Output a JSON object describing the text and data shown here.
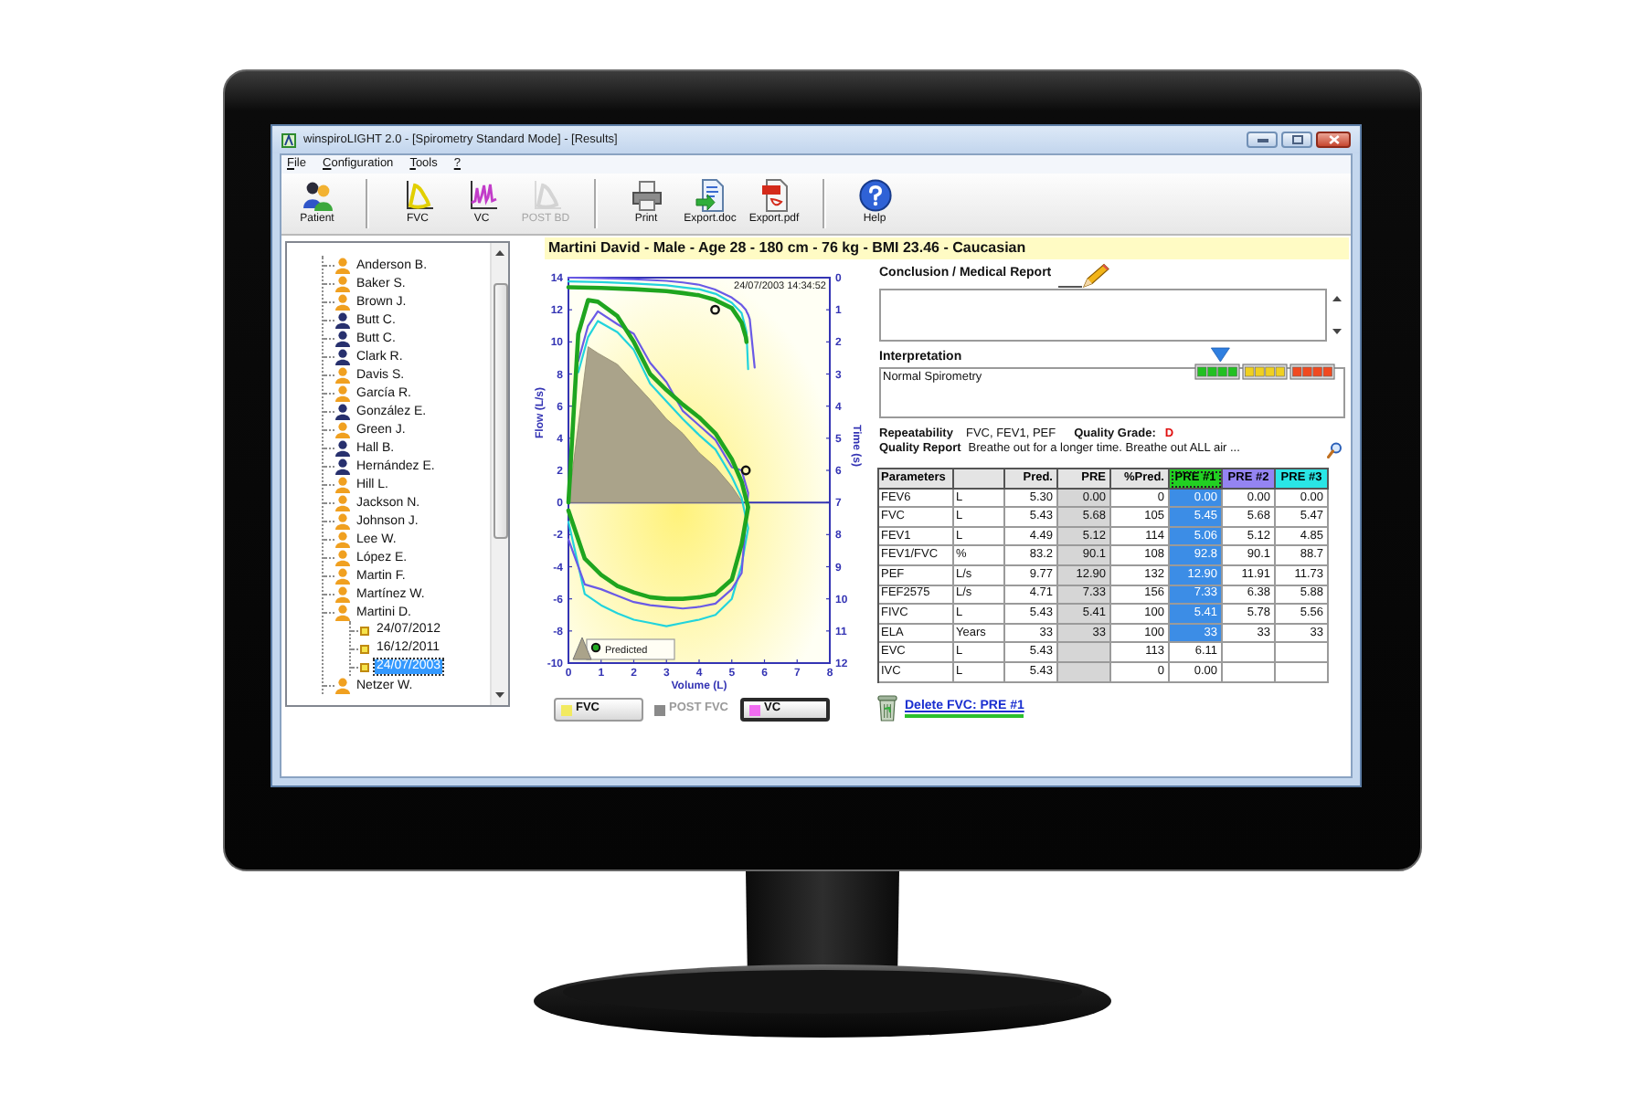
{
  "window": {
    "title": "winspiroLIGHT 2.0 - [Spirometry Standard Mode] - [Results]"
  },
  "menu": [
    {
      "label": "File"
    },
    {
      "label": "Configuration"
    },
    {
      "label": "Tools"
    },
    {
      "label": "?"
    }
  ],
  "toolbar": [
    {
      "items": [
        {
          "kind": "patient",
          "label": "Patient",
          "disabled": false
        }
      ]
    },
    {
      "items": [
        {
          "kind": "fvc",
          "label": "FVC",
          "disabled": false
        },
        {
          "kind": "vc",
          "label": "VC",
          "disabled": false
        },
        {
          "kind": "post-bd",
          "label": "POST BD",
          "disabled": true
        }
      ]
    },
    {
      "items": [
        {
          "kind": "print",
          "label": "Print",
          "disabled": false
        },
        {
          "kind": "doc",
          "label": "Export.doc",
          "disabled": false
        },
        {
          "kind": "pdf",
          "label": "Export.pdf",
          "disabled": false
        }
      ]
    },
    {
      "items": [
        {
          "kind": "help",
          "label": "Help",
          "disabled": false
        }
      ]
    }
  ],
  "patients": [
    {
      "name": "Anderson B.",
      "color": "#f0a020"
    },
    {
      "name": "Baker S.",
      "color": "#f0a020"
    },
    {
      "name": "Brown J.",
      "color": "#f0a020"
    },
    {
      "name": "Butt C.",
      "color": "#27306e"
    },
    {
      "name": "Butt C.",
      "color": "#27306e"
    },
    {
      "name": "Clark R.",
      "color": "#27306e"
    },
    {
      "name": "Davis S.",
      "color": "#f0a020"
    },
    {
      "name": "García R.",
      "color": "#f0a020"
    },
    {
      "name": "González E.",
      "color": "#27306e"
    },
    {
      "name": "Green J.",
      "color": "#f0a020"
    },
    {
      "name": "Hall B.",
      "color": "#27306e"
    },
    {
      "name": "Hernández E.",
      "color": "#27306e"
    },
    {
      "name": "Hill L.",
      "color": "#f0a020"
    },
    {
      "name": "Jackson N.",
      "color": "#f0a020"
    },
    {
      "name": "Johnson J.",
      "color": "#f0a020"
    },
    {
      "name": "Lee W.",
      "color": "#f0a020"
    },
    {
      "name": "López E.",
      "color": "#f0a020"
    },
    {
      "name": "Martin F.",
      "color": "#f0a020"
    },
    {
      "name": "Martínez W.",
      "color": "#f0a020"
    },
    {
      "name": "Martini D.",
      "color": "#f0a020",
      "children": [
        {
          "label": "24/07/2012",
          "selected": false
        },
        {
          "label": "16/12/2011",
          "selected": false
        },
        {
          "label": "24/07/2003",
          "selected": true
        }
      ]
    },
    {
      "name": "Netzer W.",
      "color": "#f0a020"
    }
  ],
  "patient_header": "Martini David - Male - Age 28 - 180 cm - 76 kg - BMI 23.46 - Caucasian",
  "chart": {
    "timestamp": "24/07/2003 14:34:52",
    "flow_volume": {
      "chart_data": {
        "type": "line",
        "xlabel": "Volume (L)",
        "ylabel": "Flow (L/s)",
        "xlim": [
          0,
          8
        ],
        "ylim": [
          -10,
          14
        ],
        "xticks": [
          0,
          1,
          2,
          3,
          4,
          5,
          6,
          7,
          8
        ],
        "yticks": [
          -10,
          -8,
          -6,
          -4,
          -2,
          0,
          2,
          4,
          6,
          8,
          10,
          12,
          14
        ],
        "x": [
          0,
          0.3,
          0.6,
          0.9,
          1.5,
          2,
          2.5,
          3,
          3.5,
          4,
          4.5,
          5,
          5.3,
          5.5,
          5.3,
          5,
          4.5,
          4,
          3.5,
          3,
          2.5,
          2,
          1.5,
          1,
          0.5,
          0
        ],
        "series": [
          {
            "name": "Predicted",
            "type": "area",
            "color": "#aaa38a",
            "values": [
              0,
              4.8,
              9.7,
              9.3,
              8.6,
              7.5,
              6.4,
              5.2,
              4.3,
              3.1,
              2.2,
              1,
              0.1,
              null,
              null,
              null,
              null,
              null,
              null,
              null,
              null,
              null,
              null,
              null,
              null,
              null
            ]
          },
          {
            "color": "#1fa51f",
            "values": [
              0,
              10.5,
              12.6,
              12.5,
              11.6,
              10,
              8,
              7,
              6.1,
              5.3,
              4.3,
              2.7,
              1.3,
              -0.3,
              -2.6,
              -4.8,
              -5.7,
              -5.9,
              -6,
              -6,
              -5.9,
              -5.6,
              -5.2,
              -4.5,
              -3.5,
              -0.5
            ]
          },
          {
            "color": "#6a5ae6",
            "values": [
              null,
              8.8,
              11,
              11.9,
              11.1,
              10.5,
              8.7,
              7.5,
              5.7,
              4.8,
              3.9,
              2.2,
              2,
              0.6,
              -4.4,
              -5.4,
              -6.3,
              -6.5,
              -6.6,
              -6.5,
              -6.4,
              -6.2,
              -5.8,
              -5.4,
              -5.1,
              -2.3
            ]
          },
          {
            "color": "#22d4dc",
            "values": [
              null,
              8.1,
              10.3,
              11.3,
              10.6,
              9.5,
              7.4,
              6.3,
              5.2,
              4.2,
              3.3,
              1.6,
              0.3,
              -1.6,
              -3.9,
              -6,
              -7,
              -7.3,
              -7.5,
              -7.7,
              -7.5,
              -7.3,
              -6.9,
              -6.4,
              -5.7,
              -1.2
            ]
          }
        ]
      }
    },
    "volume_time": {
      "chart_data": {
        "type": "line",
        "ylabel": "Time (s)",
        "xlim": [
          0,
          8
        ],
        "ylim": [
          12,
          0
        ],
        "yticks": [
          0,
          1,
          2,
          3,
          4,
          5,
          6,
          7,
          8,
          9,
          10,
          11,
          12
        ],
        "x": [
          0,
          1,
          2,
          3,
          3.5,
          4,
          4.49,
          4.5,
          5,
          5.3,
          5.43,
          5.45,
          5.5,
          5.55,
          5.7
        ],
        "series": [
          {
            "color": "#1fa51f",
            "values": [
              0.3,
              0.32,
              0.36,
              0.42,
              0.48,
              0.55,
              0.69,
              0.7,
              0.95,
              1.4,
              1.85,
              2,
              null,
              null,
              null
            ]
          },
          {
            "color": "#6a5ae6",
            "values": [
              0,
              0.02,
              0.05,
              0.1,
              0.15,
              0.22,
              0.37,
              0.38,
              0.62,
              0.85,
              1.0,
              1.05,
              1.15,
              1.3,
              2.8
            ]
          },
          {
            "color": "#22d4dc",
            "values": [
              0.12,
              0.14,
              0.18,
              0.24,
              0.3,
              0.36,
              0.5,
              0.5,
              0.78,
              1.1,
              1.6,
              1.7,
              2.85,
              null,
              null
            ]
          },
          {
            "type": "scatter",
            "color": "#111111",
            "values": [
              null,
              null,
              null,
              null,
              null,
              null,
              1,
              null,
              null,
              null,
              6,
              null,
              null,
              null,
              null
            ]
          }
        ]
      }
    },
    "curve_buttons": [
      {
        "label": "FVC",
        "color": "#f2ea60",
        "disabled": false,
        "selected": false
      },
      {
        "label": "POST FVC",
        "color": "#8a8a8a",
        "disabled": true,
        "selected": false
      },
      {
        "label": "VC",
        "color": "#f06cf0",
        "disabled": false,
        "selected": true
      }
    ]
  },
  "conclusion": {
    "label": "Conclusion / Medical Report"
  },
  "interpretation": {
    "label": "Interpretation",
    "value": "Normal Spirometry",
    "scale": {
      "level": 0.18
    }
  },
  "repeatability": {
    "label": "Repeatability",
    "value": "FVC, FEV1, PEF"
  },
  "quality_grade": {
    "label": "Quality Grade:",
    "value": "D"
  },
  "quality_report": {
    "label": "Quality Report",
    "value": "Breathe out for a longer time. Breathe out ALL air ..."
  },
  "table": {
    "columns": [
      {
        "kind": "label",
        "label": "Parameters"
      },
      {
        "kind": "unit"
      },
      {
        "kind": "number",
        "label": "Pred."
      },
      {
        "kind": "best",
        "label": "PRE"
      },
      {
        "kind": "number",
        "label": "%Pred."
      },
      {
        "kind": "trial",
        "label": "PRE #1",
        "color": "#22d022",
        "selected": true
      },
      {
        "kind": "trial",
        "label": "PRE #2",
        "color": "#9484f2",
        "selected": false
      },
      {
        "kind": "trial",
        "label": "PRE #3",
        "color": "#2ae6e6",
        "selected": false
      }
    ],
    "rows": [
      {
        "cells": [
          "FEV6",
          "L",
          "5.30",
          "0.00",
          "0",
          "0.00",
          "0.00",
          "0.00"
        ],
        "highlighted": true
      },
      {
        "cells": [
          "FVC",
          "L",
          "5.43",
          "5.68",
          "105",
          "5.45",
          "5.68",
          "5.47"
        ],
        "highlighted": true
      },
      {
        "cells": [
          "FEV1",
          "L",
          "4.49",
          "5.12",
          "114",
          "5.06",
          "5.12",
          "4.85"
        ],
        "highlighted": true
      },
      {
        "cells": [
          "FEV1/FVC",
          "%",
          "83.2",
          "90.1",
          "108",
          "92.8",
          "90.1",
          "88.7"
        ],
        "highlighted": true
      },
      {
        "cells": [
          "PEF",
          "L/s",
          "9.77",
          "12.90",
          "132",
          "12.90",
          "11.91",
          "11.73"
        ],
        "highlighted": true
      },
      {
        "cells": [
          "FEF2575",
          "L/s",
          "4.71",
          "7.33",
          "156",
          "7.33",
          "6.38",
          "5.88"
        ],
        "highlighted": true
      },
      {
        "cells": [
          "FIVC",
          "L",
          "5.43",
          "5.41",
          "100",
          "5.41",
          "5.78",
          "5.56"
        ],
        "highlighted": true
      },
      {
        "cells": [
          "ELA",
          "Years",
          "33",
          "33",
          "100",
          "33",
          "33",
          "33"
        ],
        "highlighted": true
      },
      {
        "cells": [
          "EVC",
          "L",
          "5.43",
          null,
          "113",
          "6.11",
          null,
          null
        ],
        "highlighted": false
      },
      {
        "cells": [
          "IVC",
          "L",
          "5.43",
          null,
          "0",
          "0.00",
          null,
          null
        ],
        "highlighted": false
      }
    ]
  },
  "delete_link": "Delete FVC: PRE #1"
}
